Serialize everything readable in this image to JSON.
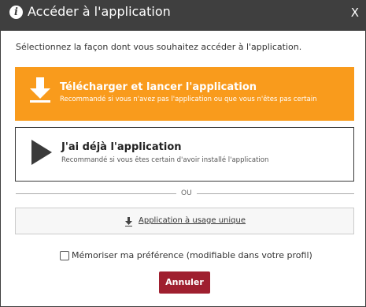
{
  "dialog": {
    "title": "Accéder à l'application",
    "close_label": "X",
    "info_glyph": "i"
  },
  "intro": "Sélectionnez la façon dont vous souhaitez accéder à l'application.",
  "options": [
    {
      "title": "Télécharger et lancer l'application",
      "subtitle": "Recommandé si vous n'avez pas l'application ou que vous n'êtes pas certain",
      "icon": "download-arrow-icon",
      "color": "#f99b1c"
    },
    {
      "title": "J'ai déjà l'application",
      "subtitle": "Recommandé si vous êtes certain d'avoir installé l'application",
      "icon": "play-icon",
      "color": "#ffffff"
    }
  ],
  "separator_label": "OU",
  "single_use": {
    "label": "Application à usage unique",
    "icon": "download-arrow-icon"
  },
  "remember": {
    "label": "Mémoriser ma préférence (modifiable dans votre profil)",
    "checked": false
  },
  "cancel_label": "Annuler",
  "colors": {
    "titlebar": "#3f3f3f",
    "accent": "#f99b1c",
    "cancel": "#9f1f2f"
  }
}
